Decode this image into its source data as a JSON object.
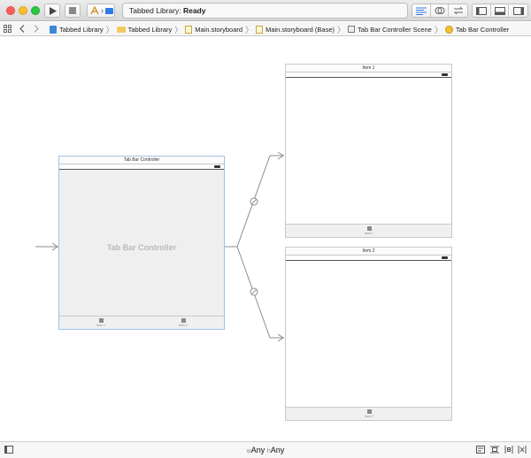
{
  "toolbar": {
    "status_app": "Tabbed Library: ",
    "status_state": "Ready"
  },
  "jumpbar": {
    "crumbs": [
      {
        "label": "Tabbed Library",
        "icon": "project-icon"
      },
      {
        "label": "Tabbed Library",
        "icon": "folder-icon"
      },
      {
        "label": "Main.storyboard",
        "icon": "storyboard-icon"
      },
      {
        "label": "Main.storyboard (Base)",
        "icon": "storyboard-icon"
      },
      {
        "label": "Tab Bar Controller Scene",
        "icon": "scene-icon"
      },
      {
        "label": "Tab Bar Controller",
        "icon": "tab-bar-controller-icon"
      }
    ]
  },
  "canvas": {
    "tab_bar_controller": {
      "title": "Tab Bar Controller",
      "placeholder": "Tab Bar Controller",
      "tabs": [
        "Item 1",
        "Item 2"
      ]
    },
    "item1_scene": {
      "title": "Item 1",
      "tab": "Item 1"
    },
    "item2_scene": {
      "title": "Item 2",
      "tab": "Item 2"
    }
  },
  "bottombar": {
    "width_prefix": "w",
    "width_value": "Any",
    "height_prefix": "h",
    "height_value": "Any"
  },
  "colors": {
    "selection_border": "#9fc3e6",
    "segue_line": "#8c8c8c",
    "active_editor": "#2c7be5"
  }
}
